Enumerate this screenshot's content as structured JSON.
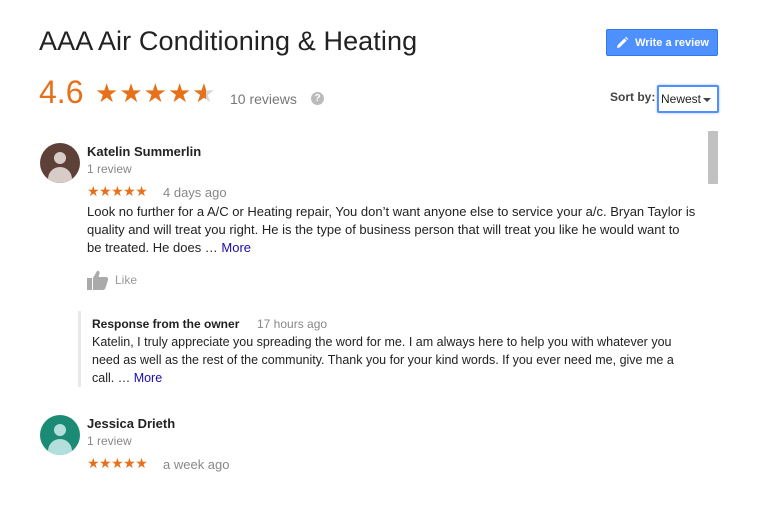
{
  "header": {
    "title": "AAA Air Conditioning & Heating",
    "write_review_label": "Write a review",
    "accent_color": "#4d90fe"
  },
  "summary": {
    "rating": "4.6",
    "rating_value": 4.6,
    "max_stars": 5,
    "reviews_label": "10 reviews",
    "help_icon": "?",
    "star_color": "#e7711b"
  },
  "sort": {
    "label": "Sort by:",
    "selected": "Newest"
  },
  "reviews": [
    {
      "name": "Katelin Summerlin",
      "review_count": "1 review",
      "stars": "★★★★★",
      "time": "4 days ago",
      "text": "Look no further for a A/C or Heating repair, You don’t want anyone else to service your a/c. Bryan Taylor is quality and will treat you right. He is the type of business person that will treat you like he would want to be treated. He does … ",
      "more": "More",
      "like": "Like",
      "avatar_color": "#5d4037",
      "owner_response": {
        "heading": "Response from the owner",
        "time": "17 hours ago",
        "text": "Katelin, I truly appreciate you spreading the word for me. I am always here to help you with whatever you need as well as the rest of the community. Thank you for your kind words. If you ever need me, give me a call. … ",
        "more": "More"
      }
    },
    {
      "name": "Jessica Drieth",
      "review_count": "1 review",
      "stars": "★★★★★",
      "time": "a week ago",
      "avatar_color": "#1c8b75"
    }
  ]
}
